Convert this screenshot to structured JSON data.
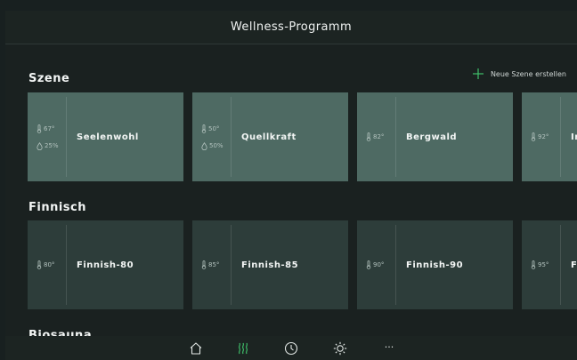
{
  "header": {
    "title": "Wellness-Programm"
  },
  "sections": {
    "scenes": {
      "title": "Szene",
      "create_label": "Neue Szene erstellen",
      "cards": [
        {
          "name": "Seelenwohl",
          "temp": "67°",
          "humidity": "25%"
        },
        {
          "name": "Quellkraft",
          "temp": "50°",
          "humidity": "50%"
        },
        {
          "name": "Bergwald",
          "temp": "82°"
        },
        {
          "name": "Ir",
          "temp": "92°"
        }
      ]
    },
    "finnish": {
      "title": "Finnisch",
      "cards": [
        {
          "name": "Finnish-80",
          "temp": "80°"
        },
        {
          "name": "Finnish-85",
          "temp": "85°"
        },
        {
          "name": "Finnish-90",
          "temp": "90°"
        },
        {
          "name": "F",
          "temp": "95°"
        }
      ]
    },
    "biosauna": {
      "title": "Biosauna"
    }
  },
  "nav": {
    "items": [
      {
        "icon": "home-icon"
      },
      {
        "icon": "sauna-heat-icon",
        "active": true
      },
      {
        "icon": "clock-icon"
      },
      {
        "icon": "light-icon"
      },
      {
        "icon": "more-icon",
        "label": "···"
      }
    ],
    "active_color": "#3fbf6a"
  },
  "colors": {
    "scene_card": "#4e6a63",
    "finnish_card": "#2d3d3a",
    "accent_green": "#3fbf6a"
  }
}
